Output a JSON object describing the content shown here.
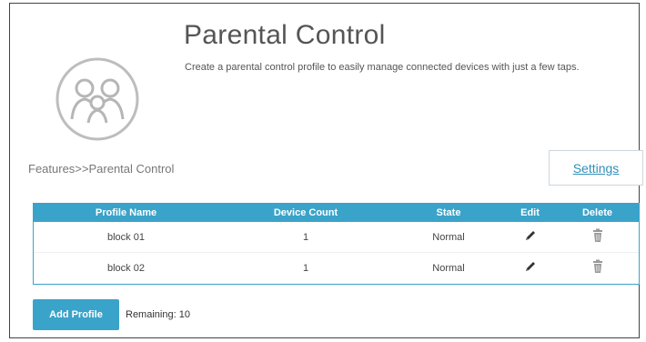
{
  "header": {
    "title": "Parental Control",
    "description": "Create a parental control profile to easily manage connected devices with just a few taps."
  },
  "breadcrumb": "Features>>Parental Control",
  "settings_button": "Settings",
  "table": {
    "columns": [
      "Profile Name",
      "Device Count",
      "State",
      "Edit",
      "Delete"
    ],
    "rows": [
      {
        "profile_name": "block 01",
        "device_count": "1",
        "state": "Normal"
      },
      {
        "profile_name": "block 02",
        "device_count": "1",
        "state": "Normal"
      }
    ]
  },
  "footer": {
    "add_profile_label": "Add Profile",
    "remaining_label": "Remaining:",
    "remaining_value": "10"
  },
  "icons": {
    "logo": "parental-control-family-icon",
    "edit": "pencil-icon",
    "delete": "trash-icon"
  },
  "colors": {
    "accent": "#3aa3c9",
    "link": "#2f8fb8",
    "title_text": "#555555"
  }
}
